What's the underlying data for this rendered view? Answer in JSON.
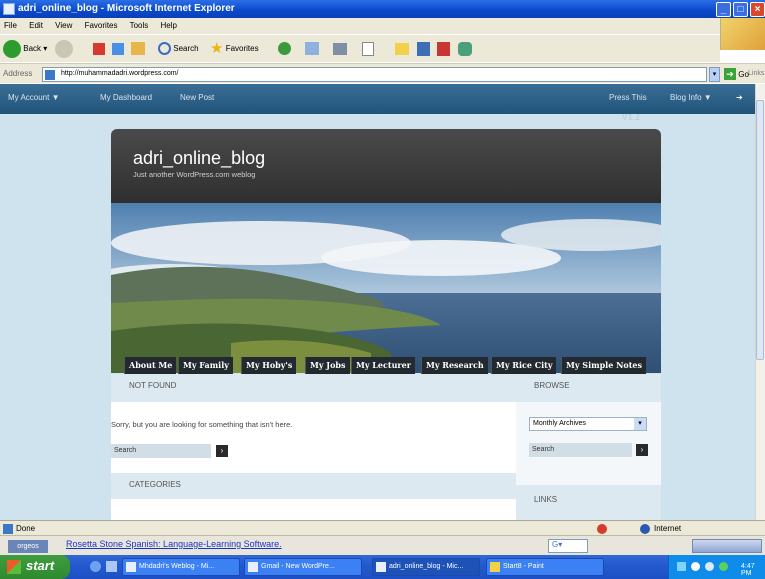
{
  "window": {
    "title": "adri_online_blog - Microsoft Internet Explorer"
  },
  "menu": [
    "File",
    "Edit",
    "View",
    "Favorites",
    "Tools",
    "Help"
  ],
  "toolbar": {
    "back_label": "Back",
    "search_label": "Search",
    "favorites_label": "Favorites"
  },
  "address": {
    "label": "Address",
    "url": "http://muhammadadri.wordpress.com/",
    "go_label": "Go",
    "links_label": "Links"
  },
  "wpbar": {
    "my_account": "My Account ▼",
    "dashboard": "My Dashboard",
    "new_post": "New Post",
    "press_this": "Press This",
    "blog_info": "Blog Info ▼",
    "version": "V1.2"
  },
  "blog": {
    "title": "adri_online_blog",
    "tagline": "Just another WordPress.com weblog"
  },
  "nav": [
    "About Me",
    "My Family",
    "My Hoby's",
    "My Jobs",
    "My Lecturer",
    "My Research",
    "My Rice City",
    "My Simple Notes"
  ],
  "main": {
    "not_found_heading": "NOT FOUND",
    "not_found_text": "Sorry, but you are looking for something that isn't here.",
    "search_value": "Search",
    "categories_heading": "CATEGORIES"
  },
  "sidebar": {
    "browse_heading": "BROWSE",
    "archives_select": "Monthly Archives",
    "search_value": "Search",
    "links_heading": "LINKS"
  },
  "status": {
    "text": "Done",
    "zone": "Internet"
  },
  "adbar": {
    "logo": "orgeos",
    "link_text": "Rosetta Stone Spanish: Language-Learning Software."
  },
  "taskbar": {
    "start_label": "start",
    "tasks": [
      "Mhdadri's Weblog - Mi...",
      "Gmail - New WordPre...",
      "adri_online_blog - Mic...",
      "Start8 - Paint"
    ],
    "clock": "4:47 PM"
  },
  "colors": {
    "accent": "#215479",
    "page_bg": "#cfe3ee",
    "header_bg": "#3a3a3a"
  }
}
